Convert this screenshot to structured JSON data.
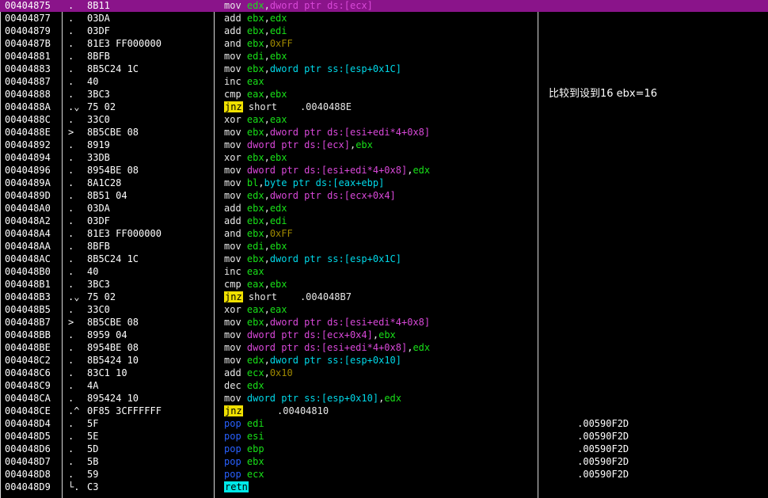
{
  "side_comment": "比较到设到16 ebx=16",
  "rows": [
    {
      "addr": "00404875",
      "mark": ".",
      "hex": "8B11",
      "selected": true,
      "ins": [
        [
          "mov ",
          "k-mov"
        ],
        [
          "edx",
          "r"
        ],
        [
          ",",
          "k-mov"
        ],
        [
          "dword ptr ds:[ecx]",
          "m"
        ]
      ],
      "cmt": ""
    },
    {
      "addr": "00404877",
      "mark": ".",
      "hex": "03DA",
      "ins": [
        [
          "add ",
          "k-plain"
        ],
        [
          "ebx",
          "r"
        ],
        [
          ",",
          "k-plain"
        ],
        [
          "edx",
          "r"
        ]
      ],
      "cmt": ""
    },
    {
      "addr": "00404879",
      "mark": ".",
      "hex": "03DF",
      "ins": [
        [
          "add ",
          "k-plain"
        ],
        [
          "ebx",
          "r"
        ],
        [
          ",",
          "k-plain"
        ],
        [
          "edi",
          "r"
        ]
      ],
      "cmt": ""
    },
    {
      "addr": "0040487B",
      "mark": ".",
      "hex": "81E3 FF000000",
      "ins": [
        [
          "and ",
          "k-plain"
        ],
        [
          "ebx",
          "r"
        ],
        [
          ",",
          "k-plain"
        ],
        [
          "0xFF",
          "n"
        ]
      ],
      "cmt": ""
    },
    {
      "addr": "00404881",
      "mark": ".",
      "hex": "8BFB",
      "ins": [
        [
          "mov ",
          "k-plain"
        ],
        [
          "edi",
          "r"
        ],
        [
          ",",
          "k-plain"
        ],
        [
          "ebx",
          "r"
        ]
      ],
      "cmt": ""
    },
    {
      "addr": "00404883",
      "mark": ".",
      "hex": "8B5C24 1C",
      "ins": [
        [
          "mov ",
          "k-plain"
        ],
        [
          "ebx",
          "r"
        ],
        [
          ",",
          "k-plain"
        ],
        [
          "dword ptr ss:[esp+0x1C]",
          "sz"
        ]
      ],
      "cmt": ""
    },
    {
      "addr": "00404887",
      "mark": ".",
      "hex": "40",
      "ins": [
        [
          "inc ",
          "k-plain"
        ],
        [
          "eax",
          "r"
        ]
      ],
      "cmt": ""
    },
    {
      "addr": "00404888",
      "mark": ".",
      "hex": "3BC3",
      "ins": [
        [
          "cmp ",
          "k-plain"
        ],
        [
          "eax",
          "r"
        ],
        [
          ",",
          "k-plain"
        ],
        [
          "ebx",
          "r"
        ]
      ],
      "cmt": "比较到设到16 ebx=16"
    },
    {
      "addr": "0040488A",
      "mark": ".⌄",
      "hex": "75 02",
      "ins": [
        [
          "jnz",
          "k-jnz"
        ],
        [
          " short ",
          "k-plain"
        ],
        [
          "   .0040488E",
          "k-plain"
        ]
      ],
      "cmt": ""
    },
    {
      "addr": "0040488C",
      "mark": ".",
      "hex": "33C0",
      "ins": [
        [
          "xor ",
          "k-plain"
        ],
        [
          "eax",
          "r"
        ],
        [
          ",",
          "k-plain"
        ],
        [
          "eax",
          "r"
        ]
      ],
      "cmt": ""
    },
    {
      "addr": "0040488E",
      "mark": ">",
      "hex": "8B5CBE 08",
      "ins": [
        [
          "mov ",
          "k-plain"
        ],
        [
          "ebx",
          "r"
        ],
        [
          ",",
          "k-plain"
        ],
        [
          "dword ptr ds:[esi+edi*4+0x8]",
          "m"
        ]
      ],
      "cmt": ""
    },
    {
      "addr": "00404892",
      "mark": ".",
      "hex": "8919",
      "ins": [
        [
          "mov ",
          "k-plain"
        ],
        [
          "dword ptr ds:[ecx]",
          "m"
        ],
        [
          ",",
          "k-plain"
        ],
        [
          "ebx",
          "r"
        ]
      ],
      "cmt": ""
    },
    {
      "addr": "00404894",
      "mark": ".",
      "hex": "33DB",
      "ins": [
        [
          "xor ",
          "k-plain"
        ],
        [
          "ebx",
          "r"
        ],
        [
          ",",
          "k-plain"
        ],
        [
          "ebx",
          "r"
        ]
      ],
      "cmt": ""
    },
    {
      "addr": "00404896",
      "mark": ".",
      "hex": "8954BE 08",
      "ins": [
        [
          "mov ",
          "k-plain"
        ],
        [
          "dword ptr ds:[esi+edi*4+0x8]",
          "m"
        ],
        [
          ",",
          "k-plain"
        ],
        [
          "edx",
          "r"
        ]
      ],
      "cmt": ""
    },
    {
      "addr": "0040489A",
      "mark": ".",
      "hex": "8A1C28",
      "ins": [
        [
          "mov ",
          "k-plain"
        ],
        [
          "bl",
          "r"
        ],
        [
          ",",
          "k-plain"
        ],
        [
          "byte ptr ds:[eax+ebp]",
          "sz"
        ]
      ],
      "cmt": ""
    },
    {
      "addr": "0040489D",
      "mark": ".",
      "hex": "8B51 04",
      "ins": [
        [
          "mov ",
          "k-plain"
        ],
        [
          "edx",
          "r"
        ],
        [
          ",",
          "k-plain"
        ],
        [
          "dword ptr ds:[ecx+0x4]",
          "m"
        ]
      ],
      "cmt": ""
    },
    {
      "addr": "004048A0",
      "mark": ".",
      "hex": "03DA",
      "ins": [
        [
          "add ",
          "k-plain"
        ],
        [
          "ebx",
          "r"
        ],
        [
          ",",
          "k-plain"
        ],
        [
          "edx",
          "r"
        ]
      ],
      "cmt": ""
    },
    {
      "addr": "004048A2",
      "mark": ".",
      "hex": "03DF",
      "ins": [
        [
          "add ",
          "k-plain"
        ],
        [
          "ebx",
          "r"
        ],
        [
          ",",
          "k-plain"
        ],
        [
          "edi",
          "r"
        ]
      ],
      "cmt": ""
    },
    {
      "addr": "004048A4",
      "mark": ".",
      "hex": "81E3 FF000000",
      "ins": [
        [
          "and ",
          "k-plain"
        ],
        [
          "ebx",
          "r"
        ],
        [
          ",",
          "k-plain"
        ],
        [
          "0xFF",
          "n"
        ]
      ],
      "cmt": ""
    },
    {
      "addr": "004048AA",
      "mark": ".",
      "hex": "8BFB",
      "ins": [
        [
          "mov ",
          "k-plain"
        ],
        [
          "edi",
          "r"
        ],
        [
          ",",
          "k-plain"
        ],
        [
          "ebx",
          "r"
        ]
      ],
      "cmt": ""
    },
    {
      "addr": "004048AC",
      "mark": ".",
      "hex": "8B5C24 1C",
      "ins": [
        [
          "mov ",
          "k-plain"
        ],
        [
          "ebx",
          "r"
        ],
        [
          ",",
          "k-plain"
        ],
        [
          "dword ptr ss:[esp+0x1C]",
          "sz"
        ]
      ],
      "cmt": ""
    },
    {
      "addr": "004048B0",
      "mark": ".",
      "hex": "40",
      "ins": [
        [
          "inc ",
          "k-plain"
        ],
        [
          "eax",
          "r"
        ]
      ],
      "cmt": ""
    },
    {
      "addr": "004048B1",
      "mark": ".",
      "hex": "3BC3",
      "ins": [
        [
          "cmp ",
          "k-plain"
        ],
        [
          "eax",
          "r"
        ],
        [
          ",",
          "k-plain"
        ],
        [
          "ebx",
          "r"
        ]
      ],
      "cmt": ""
    },
    {
      "addr": "004048B3",
      "mark": ".⌄",
      "hex": "75 02",
      "ins": [
        [
          "jnz",
          "k-jnz"
        ],
        [
          " short ",
          "k-plain"
        ],
        [
          "   .004048B7",
          "k-plain"
        ]
      ],
      "cmt": ""
    },
    {
      "addr": "004048B5",
      "mark": ".",
      "hex": "33C0",
      "ins": [
        [
          "xor ",
          "k-plain"
        ],
        [
          "eax",
          "r"
        ],
        [
          ",",
          "k-plain"
        ],
        [
          "eax",
          "r"
        ]
      ],
      "cmt": ""
    },
    {
      "addr": "004048B7",
      "mark": ">",
      "hex": "8B5CBE 08",
      "ins": [
        [
          "mov ",
          "k-plain"
        ],
        [
          "ebx",
          "r"
        ],
        [
          ",",
          "k-plain"
        ],
        [
          "dword ptr ds:[esi+edi*4+0x8]",
          "m"
        ]
      ],
      "cmt": ""
    },
    {
      "addr": "004048BB",
      "mark": ".",
      "hex": "8959 04",
      "ins": [
        [
          "mov ",
          "k-plain"
        ],
        [
          "dword ptr ds:[ecx+0x4]",
          "m"
        ],
        [
          ",",
          "k-plain"
        ],
        [
          "ebx",
          "r"
        ]
      ],
      "cmt": ""
    },
    {
      "addr": "004048BE",
      "mark": ".",
      "hex": "8954BE 08",
      "ins": [
        [
          "mov ",
          "k-plain"
        ],
        [
          "dword ptr ds:[esi+edi*4+0x8]",
          "m"
        ],
        [
          ",",
          "k-plain"
        ],
        [
          "edx",
          "r"
        ]
      ],
      "cmt": ""
    },
    {
      "addr": "004048C2",
      "mark": ".",
      "hex": "8B5424 10",
      "ins": [
        [
          "mov ",
          "k-plain"
        ],
        [
          "edx",
          "r"
        ],
        [
          ",",
          "k-plain"
        ],
        [
          "dword ptr ss:[esp+0x10]",
          "sz"
        ]
      ],
      "cmt": ""
    },
    {
      "addr": "004048C6",
      "mark": ".",
      "hex": "83C1 10",
      "ins": [
        [
          "add ",
          "k-plain"
        ],
        [
          "ecx",
          "r"
        ],
        [
          ",",
          "k-plain"
        ],
        [
          "0x10",
          "n"
        ]
      ],
      "cmt": ""
    },
    {
      "addr": "004048C9",
      "mark": ".",
      "hex": "4A",
      "ins": [
        [
          "dec ",
          "k-plain"
        ],
        [
          "edx",
          "r"
        ]
      ],
      "cmt": ""
    },
    {
      "addr": "004048CA",
      "mark": ".",
      "hex": "895424 10",
      "ins": [
        [
          "mov ",
          "k-plain"
        ],
        [
          "dword ptr ss:[esp+0x10]",
          "sz"
        ],
        [
          ",",
          "k-plain"
        ],
        [
          "edx",
          "r"
        ]
      ],
      "cmt": ""
    },
    {
      "addr": "004048CE",
      "mark": ".^",
      "hex": "0F85 3CFFFFFF",
      "ins": [
        [
          "jnz",
          "k-jnz"
        ],
        [
          "    ",
          "k-plain"
        ],
        [
          "  .00404810",
          "k-plain"
        ]
      ],
      "cmt": ""
    },
    {
      "addr": "004048D4",
      "mark": ".",
      "hex": "5F",
      "ins": [
        [
          "pop ",
          "k-pop"
        ],
        [
          "edi",
          "r"
        ]
      ],
      "cmt": "     .00590F2D"
    },
    {
      "addr": "004048D5",
      "mark": ".",
      "hex": "5E",
      "ins": [
        [
          "pop ",
          "k-pop"
        ],
        [
          "esi",
          "r"
        ]
      ],
      "cmt": "     .00590F2D"
    },
    {
      "addr": "004048D6",
      "mark": ".",
      "hex": "5D",
      "ins": [
        [
          "pop ",
          "k-pop"
        ],
        [
          "ebp",
          "r"
        ]
      ],
      "cmt": "     .00590F2D"
    },
    {
      "addr": "004048D7",
      "mark": ".",
      "hex": "5B",
      "ins": [
        [
          "pop ",
          "k-pop"
        ],
        [
          "ebx",
          "r"
        ]
      ],
      "cmt": "     .00590F2D"
    },
    {
      "addr": "004048D8",
      "mark": ".",
      "hex": "59",
      "ins": [
        [
          "pop ",
          "k-pop"
        ],
        [
          "ecx",
          "r"
        ]
      ],
      "cmt": "     .00590F2D"
    },
    {
      "addr": "004048D9",
      "mark": "└.",
      "hex": "C3",
      "ins": [
        [
          "retn",
          "k-retn"
        ]
      ],
      "cmt": ""
    }
  ]
}
